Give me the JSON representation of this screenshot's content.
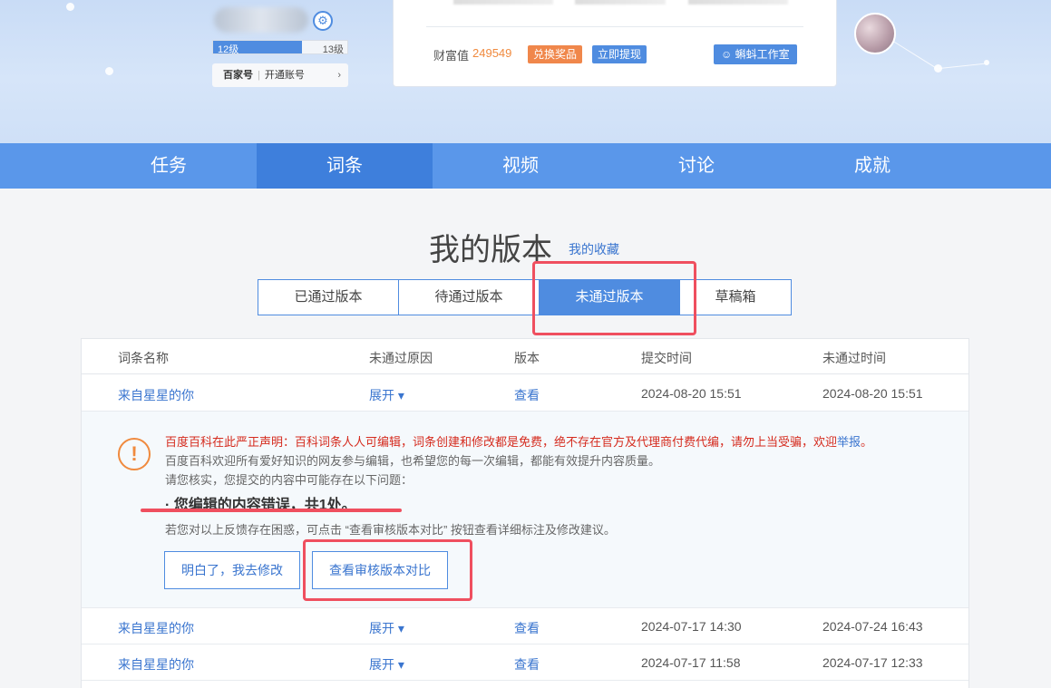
{
  "header": {
    "level": {
      "current": "12级",
      "next": "13级",
      "progress": 0.66
    },
    "baijiahao": {
      "logo": "百家号",
      "action": "开通账号",
      "chevron": "›"
    },
    "wealth": {
      "label": "财富值",
      "value": "249549"
    },
    "buttons": {
      "redeem": "兑换奖品",
      "withdraw": "立即提现",
      "studio": "蝌蚪工作室"
    }
  },
  "nav": {
    "items": [
      "任务",
      "词条",
      "视频",
      "讨论",
      "成就"
    ],
    "active_index": 1
  },
  "main": {
    "title": "我的版本",
    "favorites": "我的收藏",
    "tabs": [
      "已通过版本",
      "待通过版本",
      "未通过版本",
      "草稿箱"
    ],
    "active_tab": 2
  },
  "table": {
    "headers": [
      "词条名称",
      "未通过原因",
      "版本",
      "提交时间",
      "未通过时间"
    ],
    "rows": [
      {
        "name": "来自星星的你",
        "reason": "展开 ▾",
        "version": "查看",
        "submitted": "2024-08-20 15:51",
        "rejected": "2024-08-20 15:51"
      },
      {
        "name": "来自星星的你",
        "reason": "展开 ▾",
        "version": "查看",
        "submitted": "2024-07-17 14:30",
        "rejected": "2024-07-24 16:43"
      },
      {
        "name": "来自星星的你",
        "reason": "展开 ▾",
        "version": "查看",
        "submitted": "2024-07-17 11:58",
        "rejected": "2024-07-17 12:33"
      }
    ]
  },
  "detail": {
    "icon": "!",
    "declaration": "百度百科在此严正声明：百科词条人人可编辑，词条创建和修改都是免费，绝不存在官方及代理商付费代编，请勿上当受骗，欢迎",
    "report": "举报",
    "declaration_end": "。",
    "welcome": "百度百科欢迎所有爱好知识的网友参与编辑，也希望您的每一次编辑，都能有效提升内容质量。",
    "check": "请您核实，您提交的内容中可能存在以下问题：",
    "issue": "·  您编辑的内容错误，共1处。",
    "hint": "若您对以上反馈存在困惑，可点击 “查看审核版本对比” 按钮查看详细标注及修改建议。",
    "btn_ok": "明白了，我去修改",
    "btn_compare": "查看审核版本对比"
  },
  "colors": {
    "accent": "#4f8ce0",
    "nav": "#5a97ea",
    "warning": "#f08a3e",
    "annotation": "#ef4f5f",
    "declaration": "#d52b1e"
  }
}
